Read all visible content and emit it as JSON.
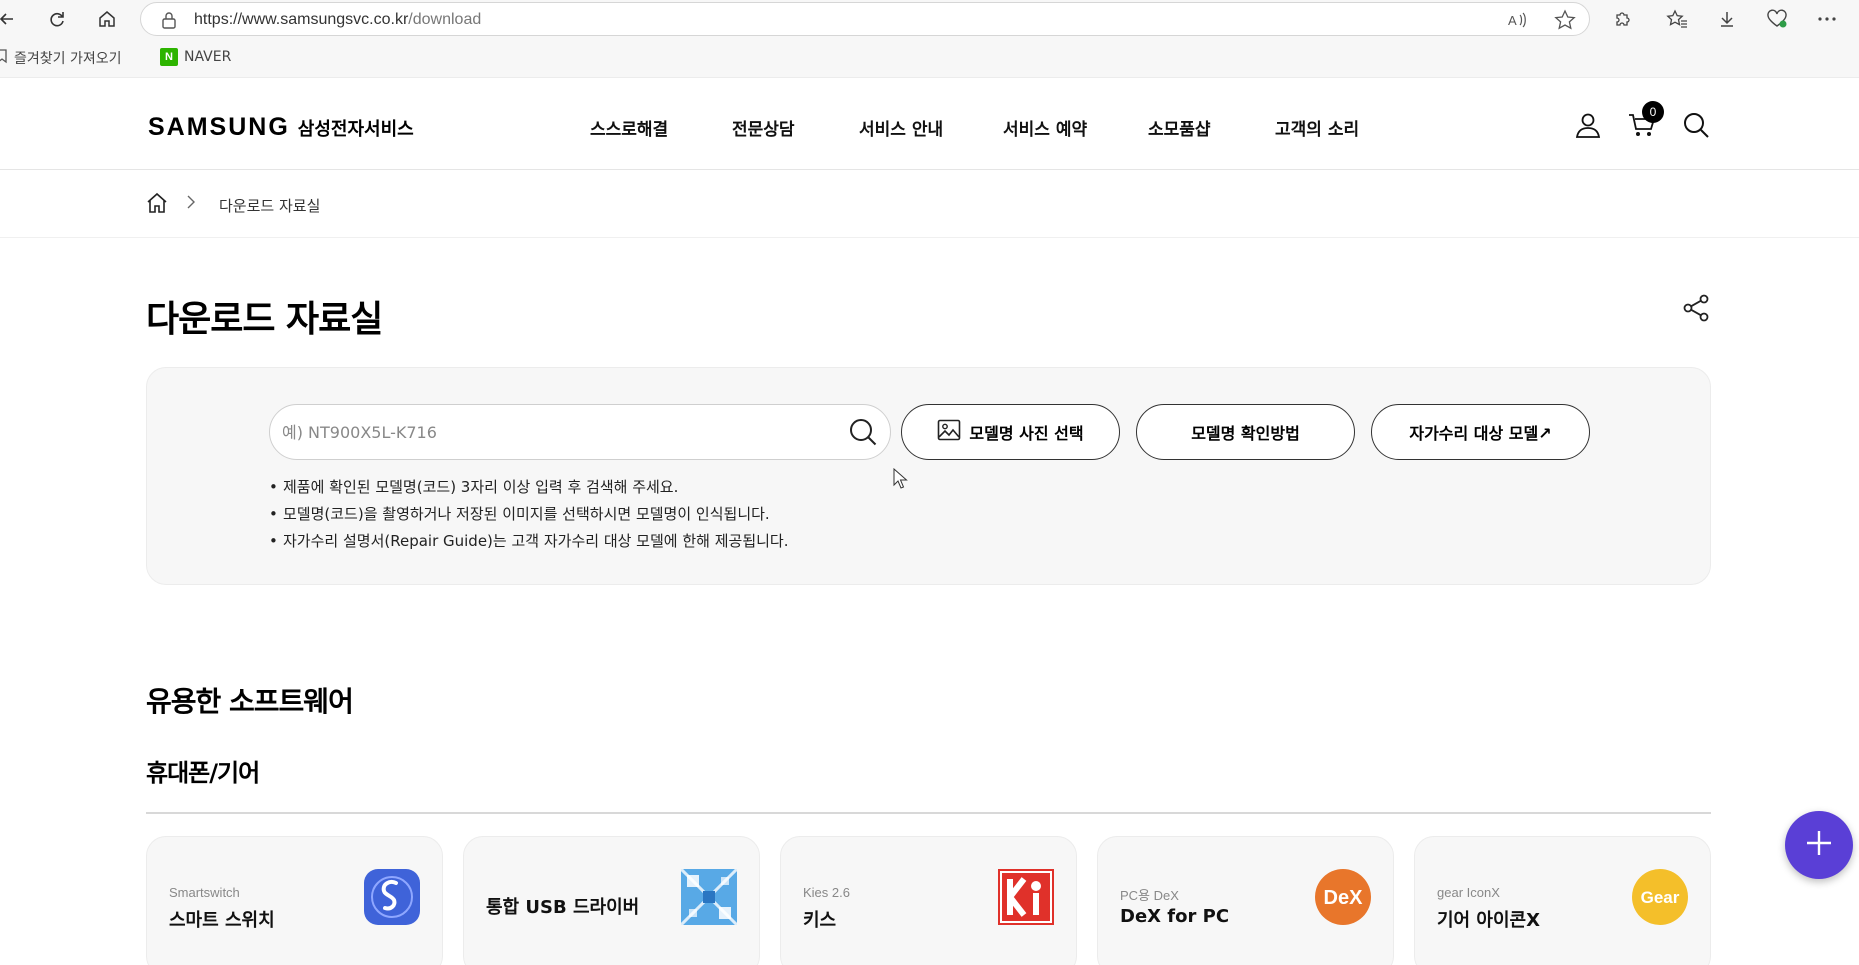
{
  "browser": {
    "url_host": "https://www.samsungsvc.co.kr",
    "url_path": "/download",
    "bookmarks": [
      {
        "label": "즐겨찾기 가져오기"
      },
      {
        "label": "NAVER",
        "logo_letter": "N"
      }
    ]
  },
  "header": {
    "logo_brand": "SAMSUNG",
    "logo_sub": "삼성전자서비스",
    "nav": [
      "스스로해결",
      "전문상담",
      "서비스 안내",
      "서비스 예약",
      "소모품샵",
      "고객의 소리"
    ],
    "cart_count": "0"
  },
  "breadcrumb": {
    "current": "다운로드 자료실"
  },
  "page": {
    "title": "다운로드 자료실"
  },
  "search": {
    "placeholder": "예) NT900X5L-K716",
    "photo_button": "모델명 사진 선택",
    "howto_button": "모델명 확인방법",
    "selfrepair_button": "자가수리 대상 모델↗",
    "notes": [
      "제품에 확인된 모델명(코드) 3자리 이상 입력 후 검색해 주세요.",
      "모델명(코드)을 촬영하거나 저장된 이미지를 선택하시면 모델명이 인식됩니다.",
      "자가수리 설명서(Repair Guide)는 고객 자가수리 대상 모델에 한해 제공됩니다."
    ]
  },
  "software": {
    "section_title": "유용한 소프트웨어",
    "category_title": "휴대폰/기어",
    "cards": [
      {
        "en": "Smartswitch",
        "ko": "스마트 스위치",
        "icon": "smartswitch-icon",
        "icon_color": "#3f63d9"
      },
      {
        "en": "",
        "ko": "통합 USB 드라이버",
        "icon": "usb-driver-icon",
        "icon_color": "#58a9e6"
      },
      {
        "en": "Kies 2.6",
        "ko": "키스",
        "icon": "kies-icon",
        "icon_color": "#e0312a"
      },
      {
        "en": "PC용 DeX",
        "ko": "DeX for PC",
        "icon": "dex-icon",
        "icon_color": "#e8762b"
      },
      {
        "en": "gear IconX",
        "ko": "기어 아이콘X",
        "icon": "gear-iconx-icon",
        "icon_color": "#f4bf2a"
      }
    ]
  },
  "icon_labels": {
    "dex": "DeX",
    "gear": "Gear"
  },
  "colors": {
    "fab": "#5a3fd6",
    "panel_bg": "#f7f7f7"
  }
}
